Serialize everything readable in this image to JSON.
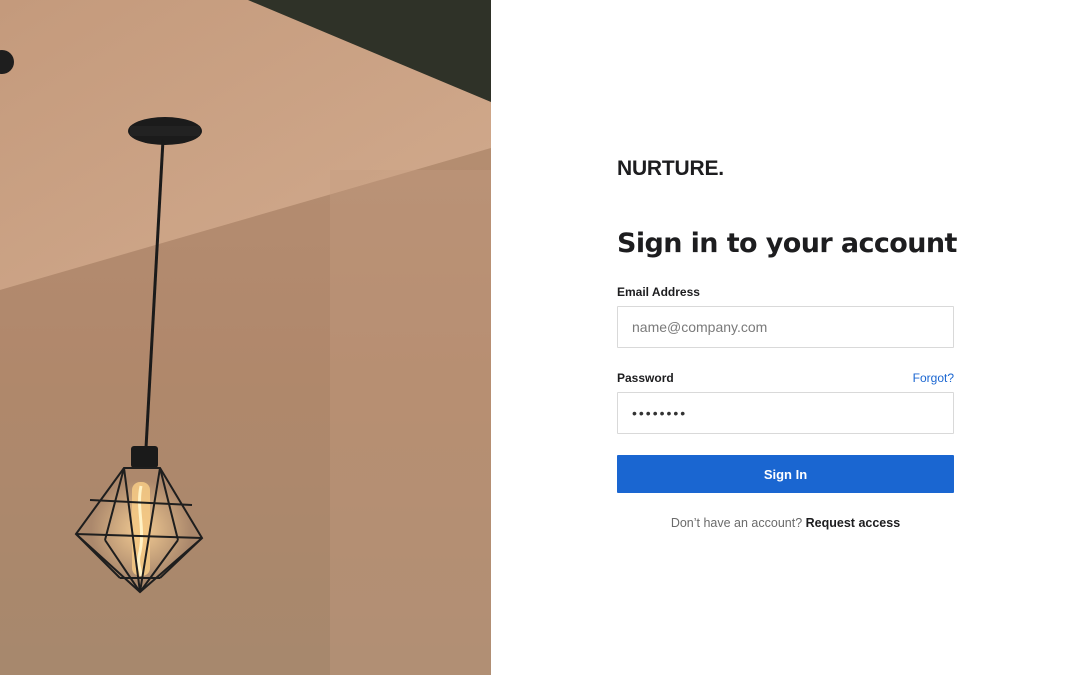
{
  "hero": {
    "image": "pendant-lamp-photo"
  },
  "brand": {
    "name": "NURTURE."
  },
  "form": {
    "heading": "Sign in to your account",
    "email_label": "Email Address",
    "email_placeholder": "name@company.com",
    "email_value": "",
    "password_label": "Password",
    "password_value": "password",
    "forgot_label": "Forgot?",
    "submit_label": "Sign In"
  },
  "footer": {
    "prompt": "Don’t have an account?",
    "link_label": "Request access"
  },
  "colors": {
    "accent": "#1a66d1",
    "text": "#1d1d1f"
  }
}
